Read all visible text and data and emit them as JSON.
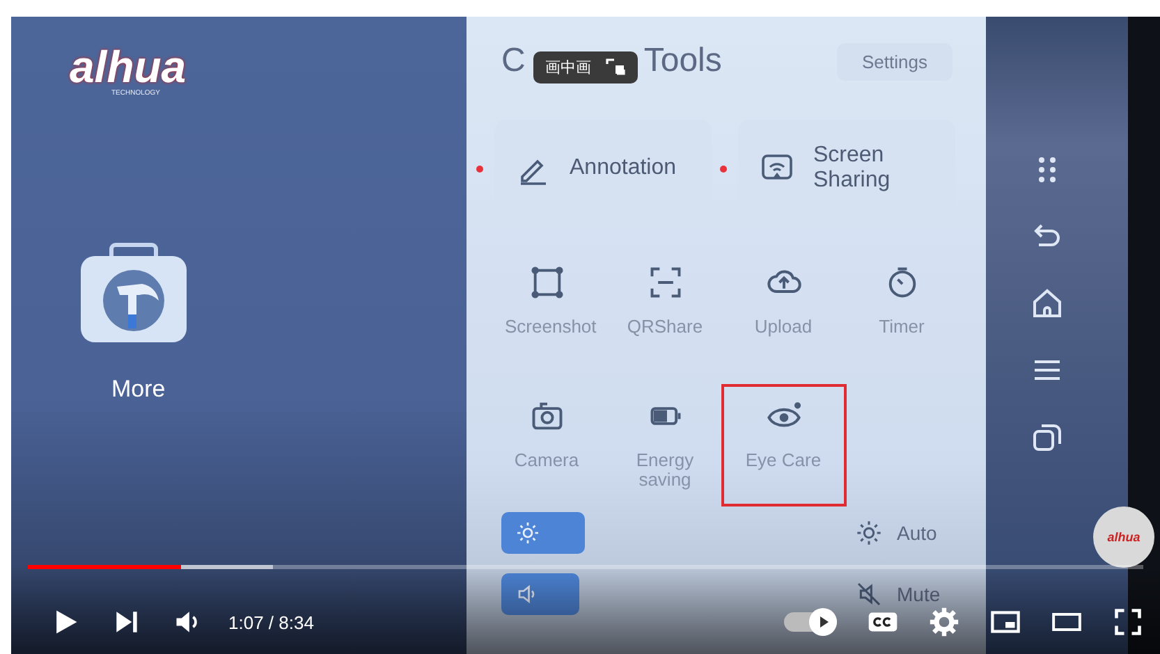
{
  "video": {
    "logo": {
      "text": "alhua",
      "subtext": "TECHNOLOGY"
    },
    "app": {
      "label": "More"
    },
    "panel": {
      "title_start": "C",
      "title_end": "Tools",
      "settings": "Settings",
      "tooltip": {
        "label": "画中画"
      },
      "cards": [
        {
          "label": "Annotation",
          "dot": true
        },
        {
          "label": "Screen Sharing",
          "dot": true
        }
      ],
      "tools": [
        {
          "label": "Screenshot",
          "highlighted": false
        },
        {
          "label": "QRShare",
          "highlighted": false
        },
        {
          "label": "Upload",
          "highlighted": false
        },
        {
          "label": "Timer",
          "highlighted": false
        },
        {
          "label": "Camera",
          "highlighted": false
        },
        {
          "label": "Energy saving",
          "highlighted": false
        },
        {
          "label": "Eye Care",
          "highlighted": true
        }
      ],
      "sliders": [
        {
          "level": 0.26,
          "option": "Auto"
        },
        {
          "level": 0.24,
          "option": "Mute"
        }
      ]
    },
    "badge": {
      "text": "alhua"
    }
  },
  "player": {
    "progress": {
      "level": 0.137
    },
    "time": "1:07 / 8:34",
    "autoplay": {
      "on": true
    }
  }
}
